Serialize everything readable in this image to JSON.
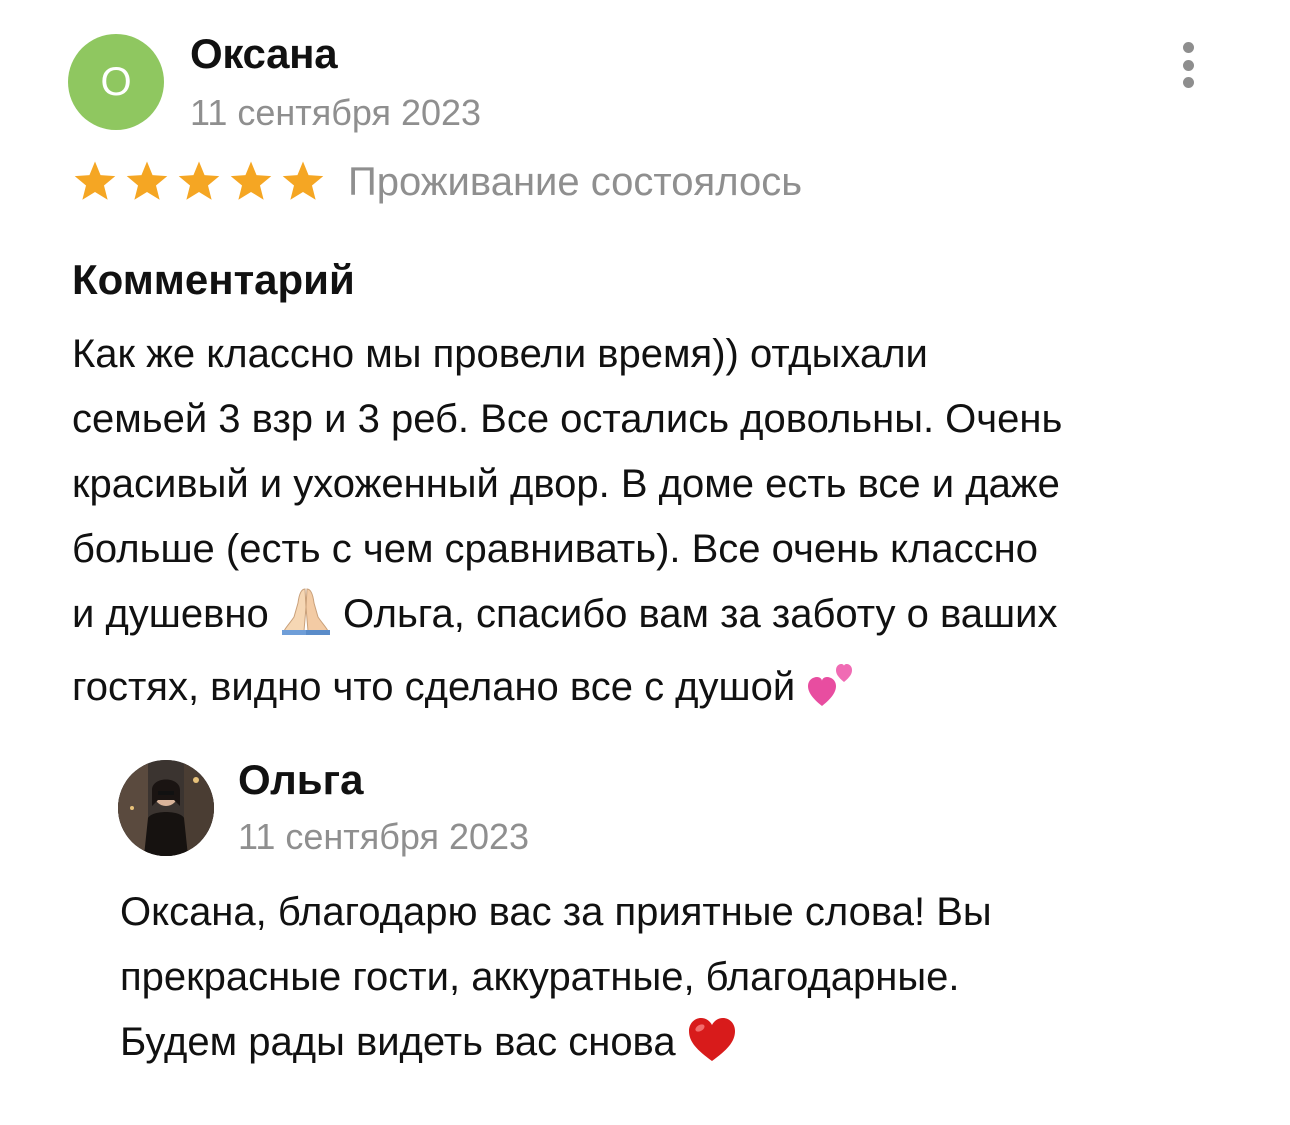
{
  "review": {
    "avatar_letter": "О",
    "author": "Оксана",
    "date": "11 сентября 2023",
    "rating": 5,
    "rating_max": 5,
    "stay_status": "Проживание состоялось",
    "comment_heading": "Комментарий",
    "comment_text": {
      "part1": "Как же классно мы провели время)) отдыхали\nсемьей 3 взр и 3 реб. Все остались довольны. Очень\nкрасивый и ухоженный двор. В доме есть все и даже\nбольше (есть с чем сравнивать). Все очень классно\nи душевно ",
      "emoji1": "folded-hands-emoji",
      "part2": " Ольга, спасибо вам за заботу о ваших\nгостях, видно что сделано все с душой ",
      "emoji2": "two-hearts-emoji"
    }
  },
  "reply": {
    "author": "Ольга",
    "date": "11 сентября 2023",
    "text": {
      "part1": "Оксана, благодарю вас за приятные слова! Вы\nпрекрасные гости, аккуратные, благодарные.\nБудем рады видеть вас снова ",
      "emoji": "red-heart-emoji"
    }
  },
  "colors": {
    "avatar_bg": "#8fc760",
    "star": "#f5a623",
    "muted_text": "#8f8f8f",
    "more_dots": "#8e8e8e"
  },
  "icons": {
    "more": "more-vertical-icon",
    "star": "star-icon"
  }
}
